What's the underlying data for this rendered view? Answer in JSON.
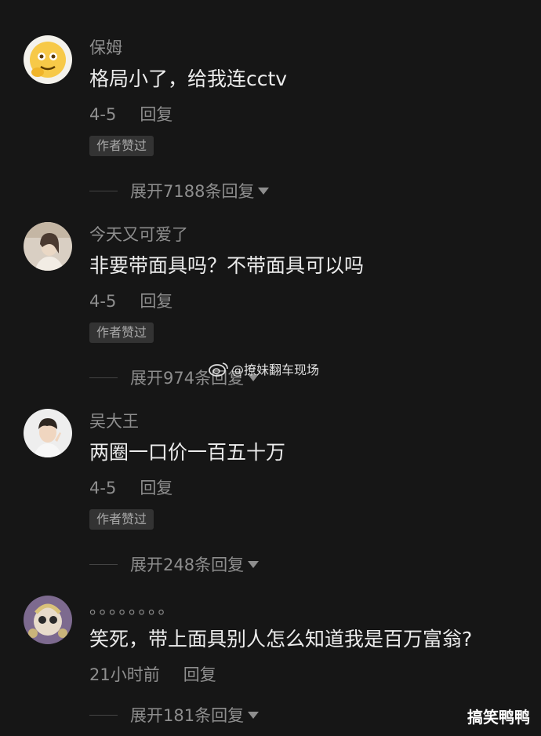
{
  "comments": [
    {
      "username": "保姆",
      "avatar": "emoji-thinking-avatar",
      "content": "格局小了，给我连cctv",
      "date": "4-5",
      "reply_label": "回复",
      "badge": "作者赞过",
      "expand_label": "展开7188条回复"
    },
    {
      "username": "今天又可爱了",
      "avatar": "girl-photo-avatar",
      "content": "非要带面具吗？不带面具可以吗",
      "date": "4-5",
      "reply_label": "回复",
      "badge": "作者赞过",
      "expand_label": "展开974条回复"
    },
    {
      "username": "吴大王",
      "avatar": "boy-photo-avatar",
      "content": "两圈一口价一百五十万",
      "date": "4-5",
      "reply_label": "回复",
      "badge": "作者赞过",
      "expand_label": "展开248条回复"
    },
    {
      "username": "。。。。。。。。",
      "avatar": "cartoon-avatar",
      "content": "笑死，带上面具别人怎么知道我是百万富翁?",
      "date": "21小时前",
      "reply_label": "回复",
      "badge": "",
      "expand_label": "展开181条回复"
    }
  ],
  "watermark": "@撩妹翻车现场",
  "corner_tag": "搞笑鸭鸭",
  "colors": {
    "background": "#161616",
    "username": "#8e8e8e",
    "content": "#ececec",
    "badge_bg": "#333333"
  }
}
